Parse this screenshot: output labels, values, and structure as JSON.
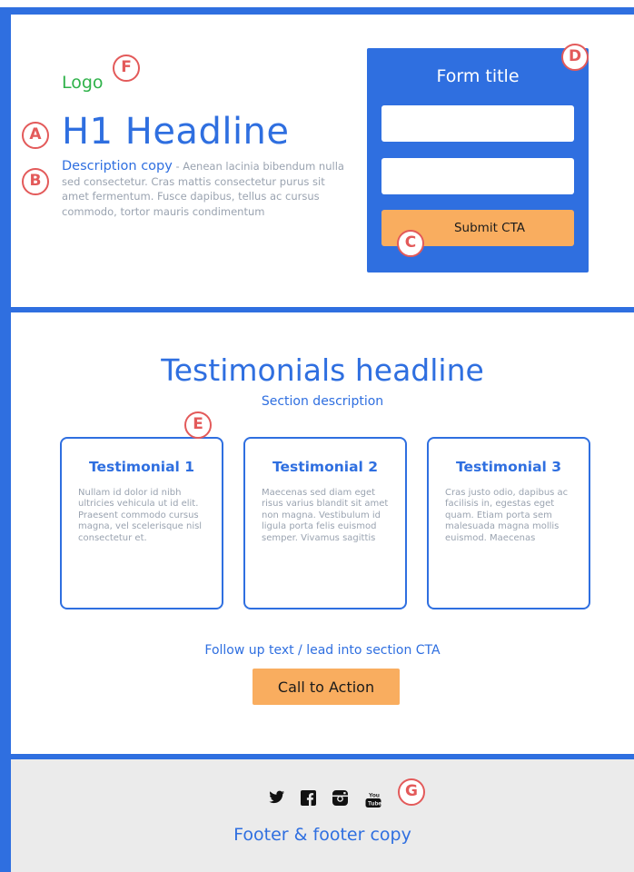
{
  "colors": {
    "primary_blue": "#2f6fe0",
    "accent_orange": "#f9ad5f",
    "logo_green": "#2fb24a",
    "marker_red": "#e35a5a",
    "footer_gray": "#ebebeb",
    "body_text_gray": "#9aa3b0"
  },
  "hero": {
    "logo": "Logo",
    "headline": "H1 Headline",
    "description_title": "Description copy",
    "description_body": " - Aenean lacinia bibendum nulla sed consectetur. Cras mattis consectetur purus sit amet fermentum. Fusce dapibus, tellus ac cursus commodo, tortor mauris condimentum"
  },
  "form": {
    "title": "Form title",
    "field_1_value": "",
    "field_2_value": "",
    "submit_label": "Submit CTA"
  },
  "testimonials": {
    "headline": "Testimonials headline",
    "description": "Section description",
    "cards": [
      {
        "title": "Testimonial 1",
        "body": "Nullam id dolor id nibh ultricies vehicula ut id elit. Praesent commodo cursus magna, vel scelerisque nisl consectetur et."
      },
      {
        "title": "Testimonial 2",
        "body": "Maecenas sed diam eget risus varius blandit sit amet non magna. Vestibulum id ligula porta felis euismod semper. Vivamus sagittis"
      },
      {
        "title": "Testimonial 3",
        "body": "Cras justo odio, dapibus ac facilisis in, egestas eget quam. Etiam porta sem malesuada magna mollis euismod. Maecenas"
      }
    ],
    "followup": "Follow up text / lead into section CTA",
    "cta_label": "Call to Action"
  },
  "footer": {
    "copy": "Footer & footer copy",
    "social_icons": [
      "twitter-icon",
      "facebook-icon",
      "instagram-icon",
      "youtube-icon"
    ],
    "youtube_glyph": "You Tube"
  },
  "markers": {
    "a": "A",
    "b": "B",
    "c": "C",
    "d": "D",
    "e": "E",
    "f": "F",
    "g": "G"
  }
}
